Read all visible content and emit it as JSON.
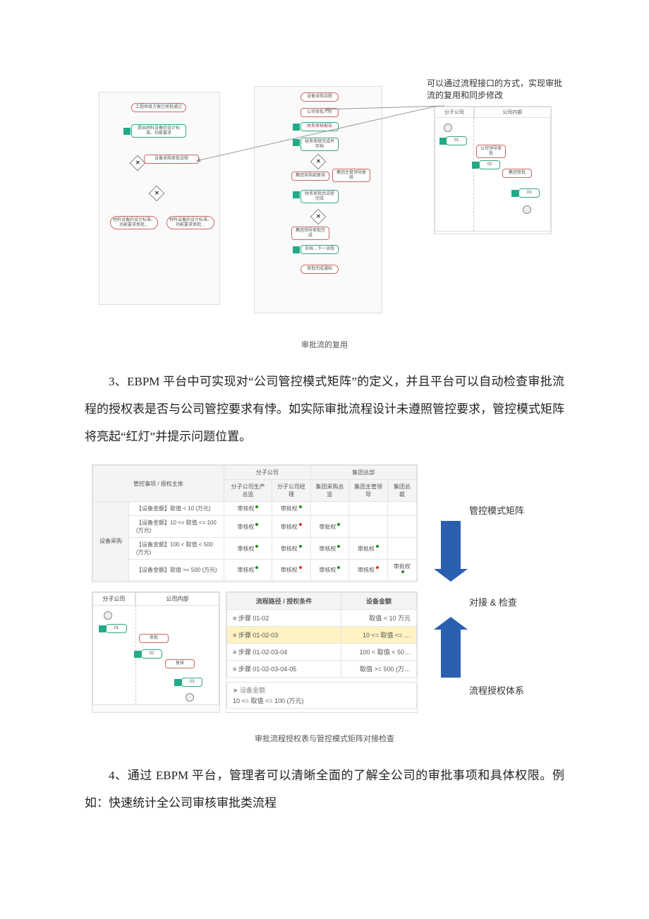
{
  "figure1": {
    "note": "可以通过流程接口的方式，实现审批流的复用和同步修改",
    "caption": "审批流的复用",
    "panelA": {
      "n1": "工程项目方案已审批通过",
      "n2": "提出材料设备的设计标准、功能要求",
      "n3": "设备采购审批流程",
      "n4": "材料设备的设计标准、功能要求审批…",
      "n5": "材料设备的设计标准、功能要求审批…"
    },
    "panelB": {
      "b1": "设备采购流程",
      "b2": "公司审批人员",
      "b3": "财务审核报告",
      "b4": "财务审核完成并存档",
      "b5": "集团采购部复核",
      "b6": "集团主管领导复核",
      "b7": "财务审批后流程完成",
      "b8": "集团领导审批完成",
      "b9": "存档→下一流程",
      "b10": "审批完成通知"
    },
    "panelC": {
      "h1": "分子公司",
      "h2": "公司内部",
      "s1": "01",
      "s2": "公司领导审批",
      "s3": "02",
      "s4": "集团审批",
      "s5": "03"
    }
  },
  "para1": "3、EBPM 平台中可实现对“公司管控模式矩阵”的定义，并且平台可以自动检查审批流程的授权表是否与公司管控要求有悖。如实际审批流程设计未遵照管控要求，管控模式矩阵将亮起“红灯”并提示问题位置。",
  "figure2": {
    "caption": "审批流程授权表与管控模式矩阵对接检查",
    "matrix": {
      "rowgroup": "设备采购",
      "h_main": "管控事项 / 授权主体",
      "group1": "分子公司",
      "group2": "集团总部",
      "cols": [
        "分子公司生产总监",
        "分子公司经理",
        "集团采购总监",
        "集团主管领导",
        "集团总裁"
      ],
      "rows": [
        {
          "label": "【设备金额】取值 < 10 (万元)",
          "cells": [
            "审核权",
            "审批权",
            "",
            "",
            ""
          ],
          "dots": [
            "g",
            "g",
            "",
            "",
            ""
          ]
        },
        {
          "label": "【设备金额】10 <= 取值 <= 100 (万元)",
          "cells": [
            "审核权",
            "审核权",
            "审批权",
            "",
            ""
          ],
          "dots": [
            "g",
            "r",
            "g",
            "",
            ""
          ]
        },
        {
          "label": "【设备金额】100 < 取值 < 500 (万元)",
          "cells": [
            "审核权",
            "审核权",
            "审核权",
            "审批权",
            ""
          ],
          "dots": [
            "g",
            "g",
            "g",
            "g",
            ""
          ]
        },
        {
          "label": "【设备金额】取值 >= 500 (万元)",
          "cells": [
            "审核权",
            "审核权",
            "审核权",
            "审核权",
            "审批权"
          ],
          "dots": [
            "g",
            "r",
            "g",
            "r",
            "g"
          ]
        }
      ]
    },
    "swim": {
      "h1": "分子公司",
      "h2": "公司内部"
    },
    "paths": {
      "h1": "流程路径 / 授权条件",
      "h2": "设备金额",
      "rows": [
        {
          "p": "≡ 步骤 01-02",
          "v": "取值 < 10 万元"
        },
        {
          "p": "≡ 步骤 01-02-03",
          "v": "10 <= 取值 <= …",
          "hl": true
        },
        {
          "p": "≡ 步骤 01-02-03-04",
          "v": "100 < 取值 < 50…"
        },
        {
          "p": "≡ 步骤 01-02-03-04-05",
          "v": "取值 >= 500 (万…"
        }
      ],
      "cond_hdr": "➤ 设备金额",
      "cond_val": "10 <= 取值 <= 100 (万元)"
    },
    "rlabels": {
      "top": "管控模式矩阵",
      "mid": "对接 & 检查",
      "bot": "流程授权体系"
    }
  },
  "para2": "4、通过 EBPM 平台，管理者可以清晰全面的了解全公司的审批事项和具体权限。例如：快速统计全公司审核审批类流程"
}
